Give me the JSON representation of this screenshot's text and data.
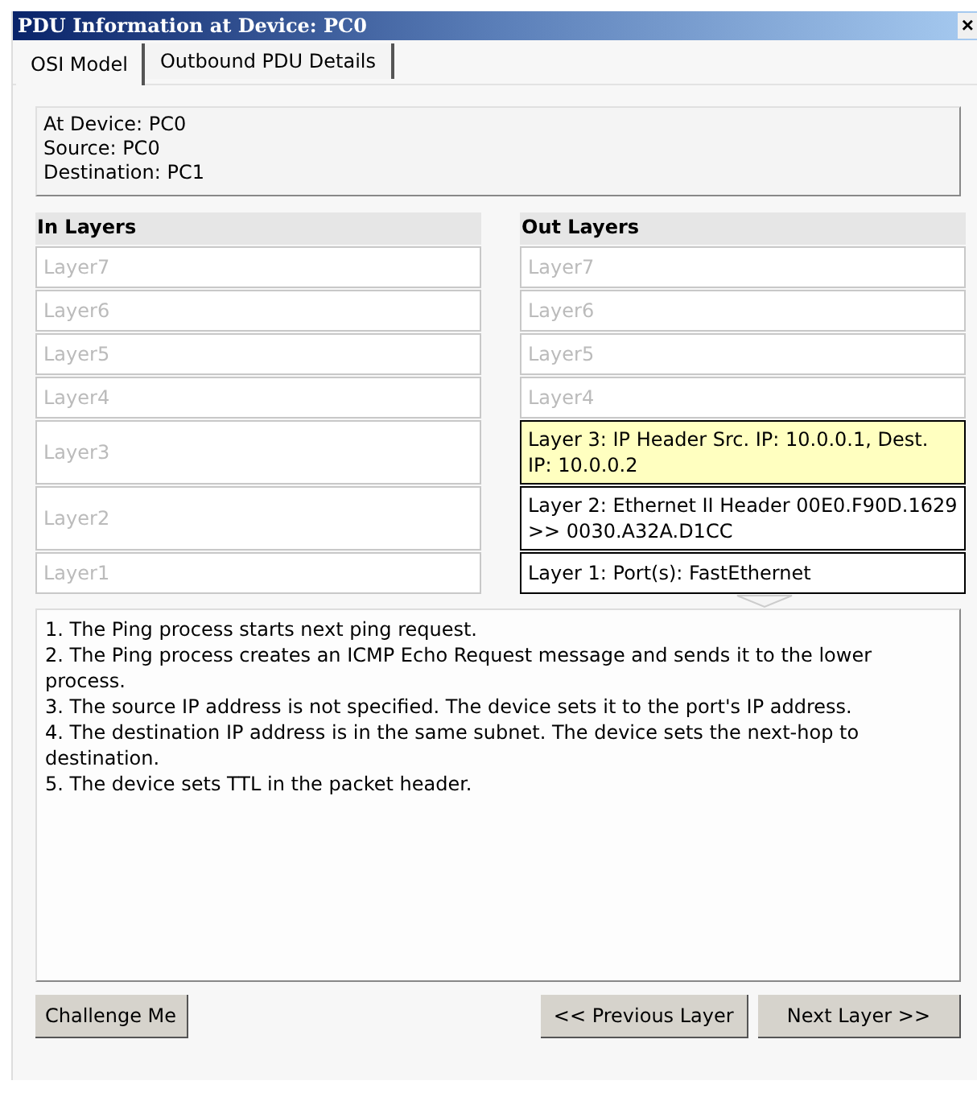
{
  "window": {
    "title": "PDU Information at Device: PC0",
    "close": "×"
  },
  "tabs": [
    {
      "label": "OSI Model",
      "selected": true
    },
    {
      "label": "Outbound PDU Details",
      "selected": false
    }
  ],
  "info": [
    "At Device: PC0",
    "Source: PC0",
    "Destination: PC1"
  ],
  "in_layers": {
    "heading": "In Layers",
    "rows": [
      {
        "text": "Layer7",
        "active": false
      },
      {
        "text": "Layer6",
        "active": false
      },
      {
        "text": "Layer5",
        "active": false
      },
      {
        "text": "Layer4",
        "active": false
      },
      {
        "text": "Layer3",
        "active": false
      },
      {
        "text": "Layer2",
        "active": false
      },
      {
        "text": "Layer1",
        "active": false
      }
    ]
  },
  "out_layers": {
    "heading": "Out Layers",
    "rows": [
      {
        "text": "Layer7",
        "active": false,
        "selected": false
      },
      {
        "text": "Layer6",
        "active": false,
        "selected": false
      },
      {
        "text": "Layer5",
        "active": false,
        "selected": false
      },
      {
        "text": "Layer4",
        "active": false,
        "selected": false
      },
      {
        "text": "Layer 3: IP Header Src. IP: 10.0.0.1, Dest. IP: 10.0.0.2",
        "active": true,
        "selected": true
      },
      {
        "text": "Layer 2: Ethernet II Header 00E0.F90D.1629 >> 0030.A32A.D1CC",
        "active": true,
        "selected": false
      },
      {
        "text": "Layer 1: Port(s): FastEthernet",
        "active": true,
        "selected": false
      }
    ]
  },
  "description": [
    "1. The Ping process starts next ping request.",
    "2. The Ping process creates an ICMP Echo Request message and sends it to the lower process.",
    "3. The source IP address is not specified. The device sets it to the port's IP address.",
    "4. The destination IP address is in the same subnet. The device sets the next-hop to destination.",
    "5. The device sets TTL in the packet header."
  ],
  "buttons": {
    "challenge": "Challenge Me",
    "previous": "<< Previous Layer",
    "next": "Next Layer >>"
  }
}
